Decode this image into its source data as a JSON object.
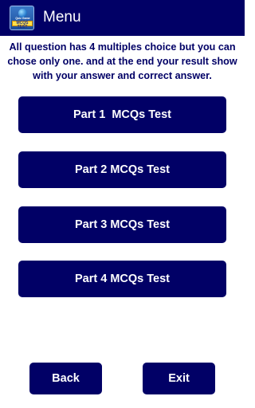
{
  "action_bar": {
    "title": "Menu",
    "icon": {
      "name": "app-logo-icon",
      "top_text": "Quiz Game",
      "banner_text": "MCQS TEST"
    }
  },
  "intro_text": "All question has 4 multiples choice but you can chose only one. and at the end your result show with your answer and correct answer.",
  "menu_buttons": [
    {
      "label": "Part 1  MCQs Test"
    },
    {
      "label": "Part 2 MCQs Test"
    },
    {
      "label": "Part 3 MCQs Test"
    },
    {
      "label": "Part 4 MCQs Test"
    }
  ],
  "footer_buttons": {
    "back": "Back",
    "exit": "Exit"
  },
  "colors": {
    "primary": "#010066",
    "background": "#ffffff",
    "button_text": "#ffffff"
  }
}
